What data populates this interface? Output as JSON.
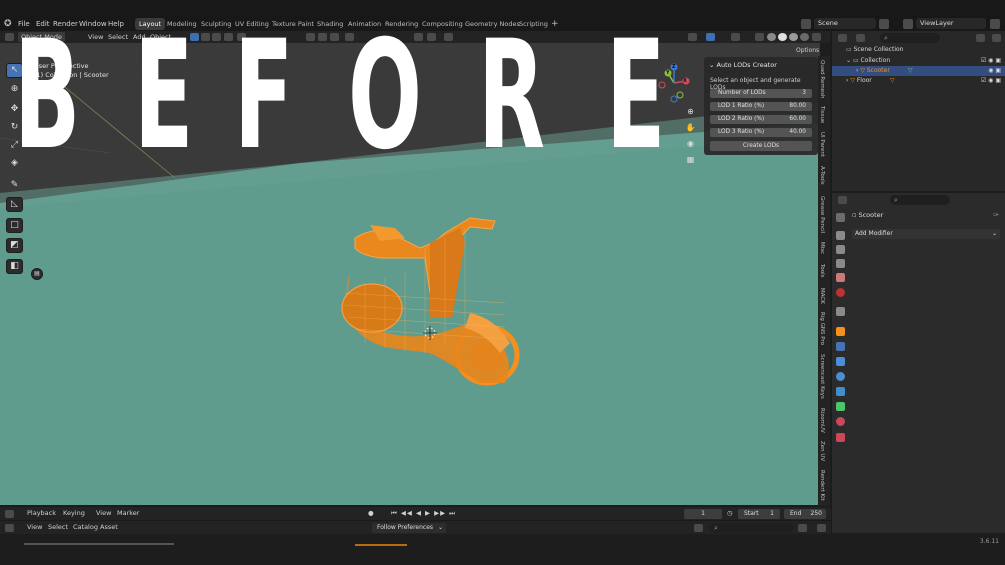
{
  "menu": [
    "File",
    "Edit",
    "Render",
    "Window",
    "Help"
  ],
  "workspaces": [
    "Layout",
    "Modeling",
    "Sculpting",
    "UV Editing",
    "Texture Paint",
    "Shading",
    "Animation",
    "Rendering",
    "Compositing",
    "Geometry Nodes",
    "Scripting"
  ],
  "active_workspace": "Layout",
  "scene_name": "Scene",
  "view_layer": "ViewLayer",
  "viewport_header": {
    "mode": "Object Mode",
    "menus": [
      "View",
      "Select",
      "Add",
      "Object"
    ]
  },
  "viewport_info": {
    "line1": "User Perspective",
    "line2": "(1) Collection | Scooter"
  },
  "overlay_title": [
    "B",
    "E",
    "F",
    "O",
    "R",
    "E"
  ],
  "gizmo": {
    "x": "X",
    "y": "Y",
    "z": "Z"
  },
  "options_label": "Options",
  "npanel": {
    "title": "Auto LODs Creator",
    "description": "Select an object and generate LODs",
    "fields": [
      {
        "label": "Number of LODs",
        "value": "3"
      },
      {
        "label": "LOD 1 Ratio (%)",
        "value": "80.00"
      },
      {
        "label": "LOD 2 Ratio (%)",
        "value": "60.00"
      },
      {
        "label": "LOD 3 Ratio (%)",
        "value": "40.00"
      }
    ],
    "button": "Create LODs"
  },
  "side_tabs": [
    "Quad Remesh",
    "Tissue",
    "UI Parent",
    "A-Tools",
    "Grease Pencil",
    "Misc",
    "Tools",
    "MACK",
    "Rig GNS Pro",
    "Screencast Keys",
    "RizomUV",
    "Zen UV",
    "Rendert Kit"
  ],
  "outliner": {
    "root": "Scene Collection",
    "rows": [
      {
        "name": "Collection",
        "level": 1
      },
      {
        "name": "Scooter",
        "level": 2,
        "selected": true
      },
      {
        "name": "Floor",
        "level": 1
      }
    ]
  },
  "properties": {
    "object": "Scooter",
    "add_modifier": "Add Modifier"
  },
  "timeline": {
    "menus": [
      "Playback",
      "Keying",
      "View",
      "Marker"
    ],
    "current_frame": "1",
    "start_label": "Start",
    "start": "1",
    "end_label": "End",
    "end": "250"
  },
  "asset_bar": {
    "menus": [
      "View",
      "Select",
      "Catalog",
      "Asset"
    ],
    "follow": "Follow Preferences"
  },
  "version": "3.6.11",
  "colors": {
    "selection": "#4772b3",
    "orange": "#f5901e",
    "floor": "#5f9c8e"
  }
}
